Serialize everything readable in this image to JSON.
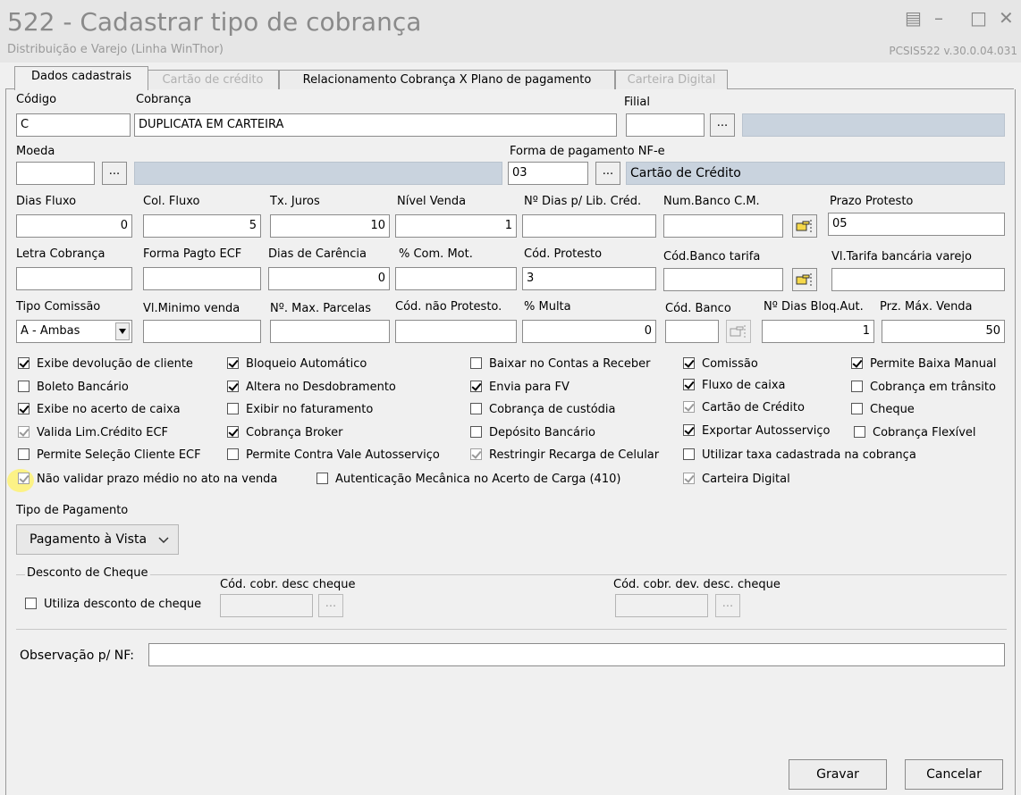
{
  "window": {
    "title": "522 - Cadastrar tipo de cobrança",
    "subtitle": "Distribuição e Varejo (Linha WinThor)",
    "version": "PCSIS522  v.30.0.04.031"
  },
  "tabs": [
    {
      "label": "Dados cadastrais"
    },
    {
      "label": "Cartão de crédito"
    },
    {
      "label": "Relacionamento Cobrança X Plano de pagamento"
    },
    {
      "label": "Carteira Digital"
    }
  ],
  "fields": {
    "codigo": {
      "label": "Código",
      "value": "C"
    },
    "cobranca": {
      "label": "Cobrança",
      "value": "DUPLICATA EM CARTEIRA"
    },
    "filial": {
      "label": "Filial",
      "value": ""
    },
    "moeda": {
      "label": "Moeda",
      "value": ""
    },
    "forma_pagamento": {
      "label": "Forma de pagamento NF-e",
      "value": "03",
      "description": "Cartão de Crédito"
    },
    "dias_fluxo": {
      "label": "Dias Fluxo",
      "value": "0"
    },
    "col_fluxo": {
      "label": "Col. Fluxo",
      "value": "5"
    },
    "tx_juros": {
      "label": "Tx. Juros",
      "value": "10"
    },
    "nivel_venda": {
      "label": "Nível Venda",
      "value": "1"
    },
    "dias_lib_cred": {
      "label": "Nº Dias p/ Lib. Créd.",
      "value": ""
    },
    "num_banco_cm": {
      "label": "Num.Banco C.M.",
      "value": ""
    },
    "prazo_protesto": {
      "label": "Prazo Protesto",
      "value": "05"
    },
    "letra_cobranca": {
      "label": "Letra Cobrança",
      "value": ""
    },
    "forma_pagto_ecf": {
      "label": "Forma Pagto ECF",
      "value": ""
    },
    "dias_carencia": {
      "label": "Dias de Carência",
      "value": "0"
    },
    "com_mot": {
      "label": "% Com. Mot.",
      "value": ""
    },
    "cod_protesto": {
      "label": "Cód. Protesto",
      "value": "3"
    },
    "cod_banco_tarifa": {
      "label": "Cód.Banco tarifa",
      "value": ""
    },
    "vl_tarifa": {
      "label": "Vl.Tarifa bancária varejo",
      "value": ""
    },
    "tipo_comissao": {
      "label": "Tipo Comissão",
      "value": "A - Ambas"
    },
    "vl_minimo_venda": {
      "label": "Vl.Minimo venda",
      "value": ""
    },
    "max_parcelas": {
      "label": "Nº. Max. Parcelas",
      "value": ""
    },
    "cod_nao_protesto": {
      "label": "Cód. não Protesto.",
      "value": ""
    },
    "multa": {
      "label": "% Multa",
      "value": "0"
    },
    "cod_banco": {
      "label": "Cód. Banco",
      "value": ""
    },
    "dias_bloq_aut": {
      "label": "Nº Dias Bloq.Aut.",
      "value": "1"
    },
    "prz_max_venda": {
      "label": "Prz. Máx. Venda",
      "value": "50"
    }
  },
  "checkboxes": [
    {
      "label": "Exibe devolução de cliente",
      "checked": true
    },
    {
      "label": "Bloqueio Automático",
      "checked": true
    },
    {
      "label": "Baixar no Contas a Receber",
      "checked": false
    },
    {
      "label": "Comissão",
      "checked": true
    },
    {
      "label": "Permite Baixa Manual",
      "checked": true
    },
    {
      "label": "Boleto Bancário",
      "checked": false
    },
    {
      "label": "Altera no Desdobramento",
      "checked": true
    },
    {
      "label": "Envia para FV",
      "checked": true
    },
    {
      "label": "Fluxo de caixa",
      "checked": true
    },
    {
      "label": "Cobrança em trânsito",
      "checked": false
    },
    {
      "label": "Exibe no acerto de caixa",
      "checked": true
    },
    {
      "label": "Exibir no faturamento",
      "checked": false
    },
    {
      "label": "Cobrança de custódia",
      "checked": false
    },
    {
      "label": "Cartão de Crédito",
      "checked": true
    },
    {
      "label": "Cheque",
      "checked": false
    },
    {
      "label": "Valida Lim.Crédito ECF",
      "checked": true
    },
    {
      "label": "Cobrança Broker",
      "checked": true
    },
    {
      "label": "Depósito Bancário",
      "checked": false
    },
    {
      "label": "Exportar Autosserviço",
      "checked": true
    },
    {
      "label": "Cobrança Flexível",
      "checked": false
    },
    {
      "label": "Permite Seleção Cliente ECF",
      "checked": false
    },
    {
      "label": "Permite Contra Vale Autosserviço",
      "checked": false
    },
    {
      "label": "Restringir Recarga de Celular",
      "checked": true
    },
    {
      "label": "Utilizar taxa cadastrada na cobrança",
      "checked": false
    },
    {
      "label": "Não validar prazo médio no ato na venda",
      "checked": true
    },
    {
      "label": "Autenticação Mecânica no Acerto de Carga (410)",
      "checked": false
    },
    {
      "label": "Carteira Digital",
      "checked": true
    }
  ],
  "payment": {
    "label": "Tipo de Pagamento",
    "value": "Pagamento à Vista"
  },
  "desconto": {
    "group_label": "Desconto de Cheque",
    "checkbox_label": "Utiliza desconto de cheque",
    "cod_desc_label": "Cód. cobr. desc cheque",
    "cod_dev_label": "Cód. cobr. dev. desc. cheque"
  },
  "observacao": {
    "label": "Observação p/ NF:",
    "value": ""
  },
  "buttons": {
    "gravar": "Gravar",
    "cancelar": "Cancelar",
    "ellipsis": "..."
  }
}
